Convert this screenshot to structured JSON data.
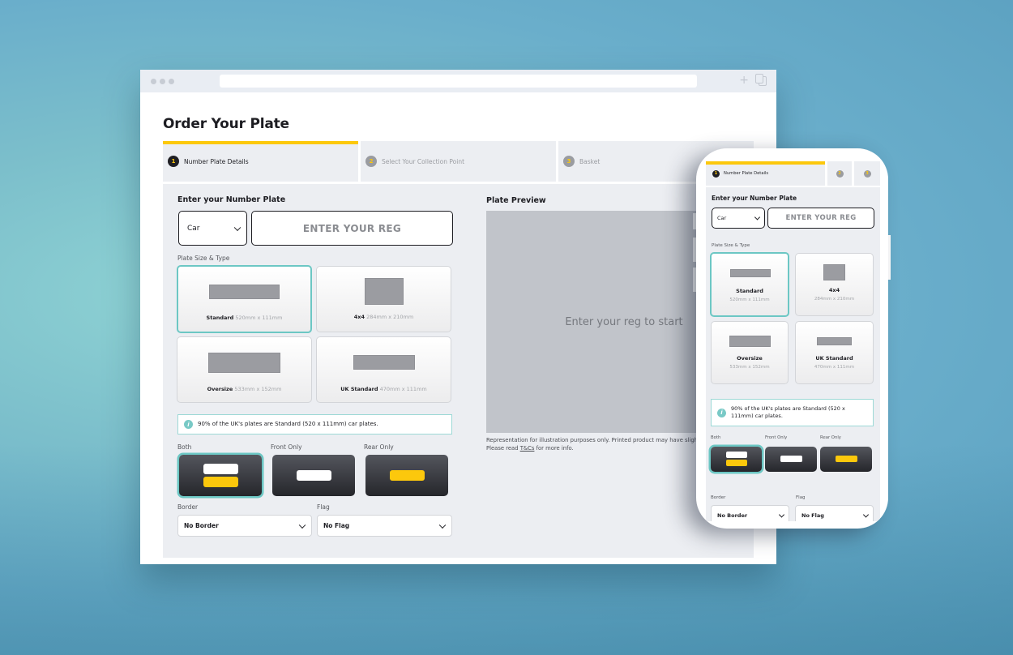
{
  "desktop": {
    "page_title": "Order Your Plate",
    "steps": [
      {
        "number": "1",
        "label": "Number Plate Details",
        "active": true
      },
      {
        "number": "2",
        "label": "Select Your Collection Point",
        "active": false
      },
      {
        "number": "3",
        "label": "Basket",
        "active": false
      }
    ],
    "enter_plate_label": "Enter your Number Plate",
    "vehicle_select": {
      "value": "Car"
    },
    "reg_input": {
      "placeholder": "ENTER YOUR REG",
      "value": ""
    },
    "plate_size_label": "Plate Size & Type",
    "plate_sizes": [
      {
        "name": "Standard",
        "dimensions": "520mm x 111mm",
        "selected": true
      },
      {
        "name": "4x4",
        "dimensions": "284mm x 210mm",
        "selected": false
      },
      {
        "name": "Oversize",
        "dimensions": "533mm x 152mm",
        "selected": false
      },
      {
        "name": "UK Standard",
        "dimensions": "470mm x 111mm",
        "selected": false
      }
    ],
    "info_text": "90% of the UK's plates are Standard (520 x 111mm) car plates.",
    "positions": [
      {
        "label": "Both",
        "selected": true
      },
      {
        "label": "Front Only",
        "selected": false
      },
      {
        "label": "Rear Only",
        "selected": false
      }
    ],
    "border": {
      "label": "Border",
      "value": "No Border"
    },
    "flag": {
      "label": "Flag",
      "value": "No Flag"
    },
    "preview": {
      "title": "Plate Preview",
      "placeholder": "Enter your reg to start",
      "note_line1": "Representation for illustration purposes only. Printed product may have slight v",
      "note_prefix": "Please read ",
      "note_link": "T&Cs",
      "note_suffix": " for more info."
    }
  },
  "mobile": {
    "steps": [
      {
        "number": "1",
        "label": "Number Plate Details",
        "active": true
      },
      {
        "number": "2",
        "label": "",
        "active": false
      },
      {
        "number": "3",
        "label": "",
        "active": false
      }
    ],
    "enter_plate_label": "Enter your Number Plate",
    "vehicle_select": {
      "value": "Car"
    },
    "reg_input": {
      "placeholder": "ENTER YOUR REG",
      "value": ""
    },
    "plate_size_label": "Plate Size & Type",
    "plate_sizes": [
      {
        "name": "Standard",
        "dimensions": "520mm x 111mm",
        "selected": true
      },
      {
        "name": "4x4",
        "dimensions": "284mm x 210mm",
        "selected": false
      },
      {
        "name": "Oversize",
        "dimensions": "533mm x 152mm",
        "selected": false
      },
      {
        "name": "UK Standard",
        "dimensions": "470mm x 111mm",
        "selected": false
      }
    ],
    "info_text": "90% of the UK's plates are Standard (520 x 111mm) car plates.",
    "positions": [
      {
        "label": "Both",
        "selected": true
      },
      {
        "label": "Front Only",
        "selected": false
      },
      {
        "label": "Rear Only",
        "selected": false
      }
    ],
    "border": {
      "label": "Border",
      "value": "No Border"
    },
    "flag": {
      "label": "Flag",
      "value": "No Flag"
    }
  },
  "colors": {
    "accent_yellow": "#fcc80c",
    "selection_teal": "#6cc7c4",
    "text_dark": "#1d1d22",
    "panel_bg": "#eceef2"
  }
}
